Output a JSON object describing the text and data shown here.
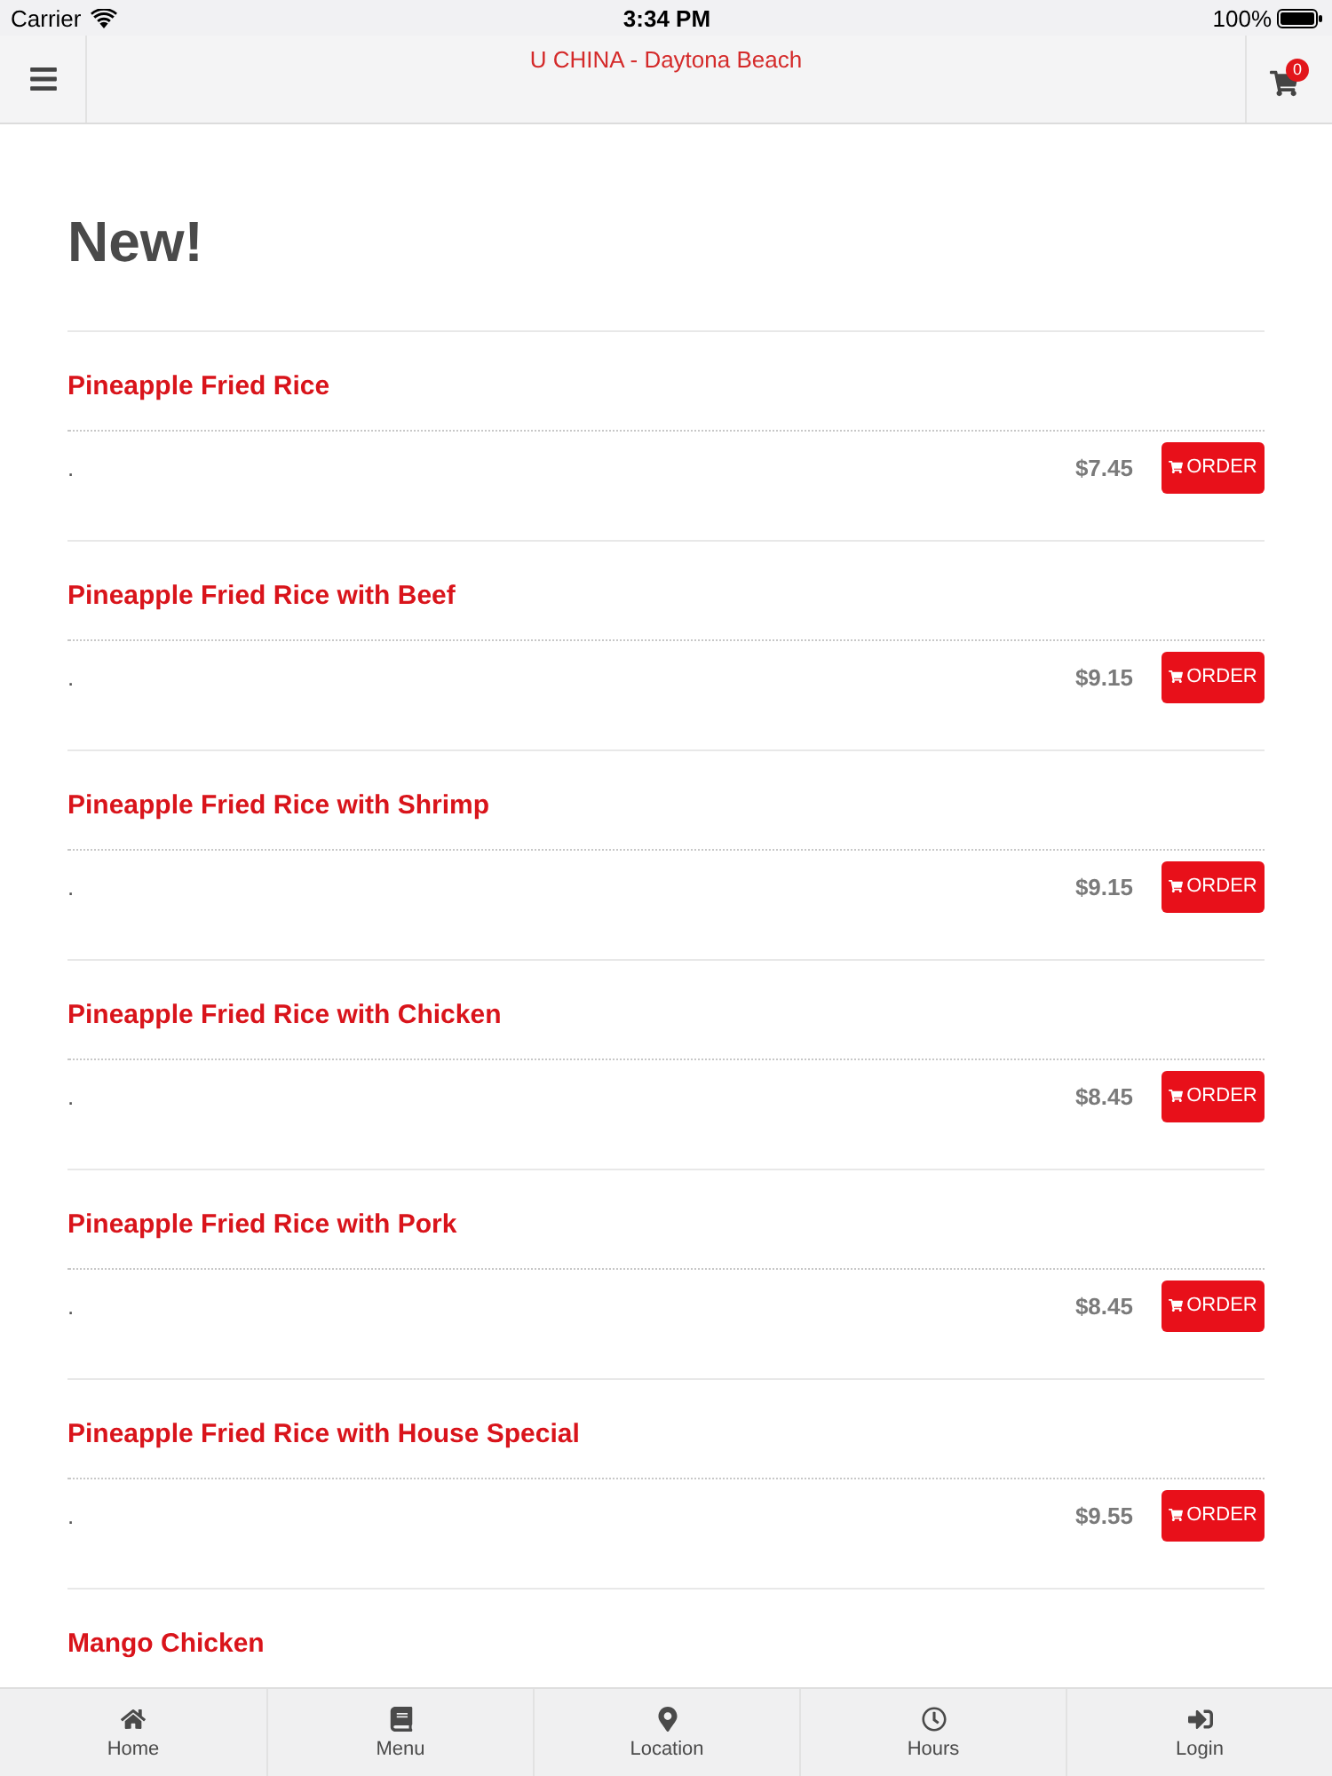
{
  "status_bar": {
    "carrier": "Carrier",
    "time": "3:34 PM",
    "battery": "100%"
  },
  "nav_bar": {
    "title": "U CHINA - Daytona Beach",
    "cart_count": "0"
  },
  "section": {
    "title": "New!",
    "items": [
      {
        "name": "Pineapple Fried Rice",
        "description": ".",
        "price": "$7.45",
        "button": "ORDER"
      },
      {
        "name": "Pineapple Fried Rice with Beef",
        "description": ".",
        "price": "$9.15",
        "button": "ORDER"
      },
      {
        "name": "Pineapple Fried Rice with Shrimp",
        "description": ".",
        "price": "$9.15",
        "button": "ORDER"
      },
      {
        "name": "Pineapple Fried Rice with Chicken",
        "description": ".",
        "price": "$8.45",
        "button": "ORDER"
      },
      {
        "name": "Pineapple Fried Rice with Pork",
        "description": ".",
        "price": "$8.45",
        "button": "ORDER"
      },
      {
        "name": "Pineapple Fried Rice with House Special",
        "description": ".",
        "price": "$9.55",
        "button": "ORDER"
      },
      {
        "name": "Mango Chicken"
      }
    ]
  },
  "tab_bar": [
    {
      "label": "Home",
      "selected": false
    },
    {
      "label": "Menu",
      "selected": false
    },
    {
      "label": "Location",
      "selected": false
    },
    {
      "label": "Hours",
      "selected": false
    },
    {
      "label": "Login",
      "selected": false
    }
  ]
}
